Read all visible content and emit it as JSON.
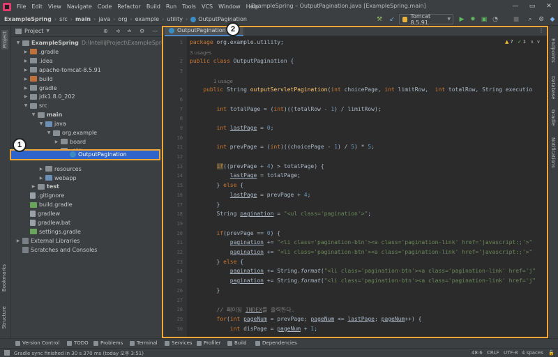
{
  "menubar": {
    "items": [
      "File",
      "Edit",
      "View",
      "Navigate",
      "Code",
      "Refactor",
      "Build",
      "Run",
      "Tools",
      "VCS",
      "Window",
      "Help"
    ],
    "window_title": "ExampleSpring – OutputPagination.java [ExampleSpring.main]"
  },
  "navbar": {
    "crumbs": [
      "ExampleSpring",
      "src",
      "main",
      "java",
      "org",
      "example",
      "utility",
      "OutputPagination"
    ],
    "run_config": "Tomcat 8.5.91"
  },
  "project_panel": {
    "title": "Project",
    "tree": [
      {
        "label": "ExampleSpring",
        "extra": "D:\\IntelliJProject\\ExampleSpring",
        "depth": 0,
        "arrow": "open",
        "icon": "folder",
        "bold": true
      },
      {
        "label": ".gradle",
        "depth": 1,
        "arrow": "closed",
        "icon": "orange"
      },
      {
        "label": ".idea",
        "depth": 1,
        "arrow": "closed",
        "icon": "folder"
      },
      {
        "label": "apache-tomcat-8.5.91",
        "depth": 1,
        "arrow": "closed",
        "icon": "folder"
      },
      {
        "label": "build",
        "depth": 1,
        "arrow": "closed",
        "icon": "orange"
      },
      {
        "label": "gradle",
        "depth": 1,
        "arrow": "closed",
        "icon": "folder"
      },
      {
        "label": "jdk1.8.0_202",
        "depth": 1,
        "arrow": "closed",
        "icon": "folder"
      },
      {
        "label": "src",
        "depth": 1,
        "arrow": "open",
        "icon": "folder"
      },
      {
        "label": "main",
        "depth": 2,
        "arrow": "open",
        "icon": "folder",
        "bold": true
      },
      {
        "label": "java",
        "depth": 3,
        "arrow": "open",
        "icon": "blue"
      },
      {
        "label": "org.example",
        "depth": 4,
        "arrow": "open",
        "icon": "folder"
      },
      {
        "label": "board",
        "depth": 5,
        "arrow": "closed",
        "icon": "folder"
      },
      {
        "label": "utility",
        "depth": 5,
        "arrow": "open",
        "icon": "folder"
      },
      {
        "label": "OutputPagination",
        "depth": 6,
        "arrow": "none",
        "icon": "class",
        "selected": true
      },
      {
        "label": "resources",
        "depth": 3,
        "arrow": "closed",
        "icon": "folder"
      },
      {
        "label": "webapp",
        "depth": 3,
        "arrow": "closed",
        "icon": "blue"
      },
      {
        "label": "test",
        "depth": 2,
        "arrow": "closed",
        "icon": "folder",
        "bold": true
      },
      {
        "label": ".gitignore",
        "depth": 1,
        "arrow": "none",
        "icon": "file"
      },
      {
        "label": "build.gradle",
        "depth": 1,
        "arrow": "none",
        "icon": "green"
      },
      {
        "label": "gradlew",
        "depth": 1,
        "arrow": "none",
        "icon": "file"
      },
      {
        "label": "gradlew.bat",
        "depth": 1,
        "arrow": "none",
        "icon": "file"
      },
      {
        "label": "settings.gradle",
        "depth": 1,
        "arrow": "none",
        "icon": "green"
      },
      {
        "label": "External Libraries",
        "depth": 0,
        "arrow": "closed",
        "icon": "lib"
      },
      {
        "label": "Scratches and Consoles",
        "depth": 0,
        "arrow": "none",
        "icon": "lib"
      }
    ]
  },
  "left_strip": {
    "project": "Project",
    "bookmarks": "Bookmarks",
    "structure": "Structure"
  },
  "right_strip": {
    "endpoints": "Endpoints",
    "database": "Database",
    "gradle": "Gradle",
    "notifications": "Notifications"
  },
  "editor": {
    "tab_label": "OutputPagination.java",
    "inspections": {
      "warnings": "7",
      "ok": "1"
    },
    "lines": [
      {
        "n": "1",
        "html": "<span class=\"kw\">package</span> org.example.utility;"
      },
      {
        "hint": "3 usages"
      },
      {
        "n": "2",
        "html": "<span class=\"kw\">public class</span> OutputPagination {"
      },
      {
        "n": "3",
        "html": ""
      },
      {
        "hint": "1 usage",
        "indent": 1
      },
      {
        "n": "5",
        "html": "    <span class=\"kw\">public</span> String <span class=\"fn\">outputServletPagination</span>(<span class=\"kw\">int</span> choicePage, <span class=\"kw\">int</span> limitRow,  <span class=\"kw\">int</span> totalRow, String executio"
      },
      {
        "n": "6",
        "html": ""
      },
      {
        "n": "7",
        "html": "        <span class=\"kw\">int</span> totalPage = (<span class=\"kw\">int</span>)((totalRow - <span class=\"num\">1</span>) / limitRow);"
      },
      {
        "n": "8",
        "html": ""
      },
      {
        "n": "9",
        "html": "        <span class=\"kw\">int</span> <span class=\"ul\">lastPage</span> = <span class=\"num\">0</span>;"
      },
      {
        "n": "10",
        "html": ""
      },
      {
        "n": "11",
        "html": "        <span class=\"kw\">int</span> prevPage = (<span class=\"kw\">int</span>)((choicePage - <span class=\"num\">1</span>) / <span class=\"num\">5</span>) * <span class=\"num\">5</span>;"
      },
      {
        "n": "12",
        "html": ""
      },
      {
        "n": "13",
        "html": "        <span class=\"kw\" style=\"background:#52503a\">if</span>((prevPage + <span class=\"num\">4</span>) > totalPage) {"
      },
      {
        "n": "14",
        "html": "            <span class=\"ul\">lastPage</span> = totalPage;"
      },
      {
        "n": "15",
        "html": "        } <span class=\"kw\">else</span> {"
      },
      {
        "n": "16",
        "html": "            <span class=\"ul\">lastPage</span> = prevPage + <span class=\"num\">4</span>;"
      },
      {
        "n": "17",
        "html": "        }"
      },
      {
        "n": "18",
        "html": "        String <span class=\"ul\">pagination</span> = <span class=\"str\">\"&lt;ul class='pagination'&gt;\"</span>;"
      },
      {
        "n": "19",
        "html": ""
      },
      {
        "n": "20",
        "html": "        <span class=\"kw\">if</span>(prevPage == <span class=\"num\">0</span>) {"
      },
      {
        "n": "21",
        "html": "            <span class=\"ul\">pagination</span> += <span class=\"str\">\"&lt;li class='pagination-btn'&gt;&lt;a class='pagination-link' href='javascript:;'&gt;\"</span>"
      },
      {
        "n": "22",
        "html": "            <span class=\"ul\">pagination</span> += <span class=\"str\">\"&lt;li class='pagination-btn'&gt;&lt;a class='pagination-link' href='javascript:;'&gt;\"</span>"
      },
      {
        "n": "23",
        "html": "        } <span class=\"kw\">else</span> {"
      },
      {
        "n": "24",
        "html": "            <span class=\"ul\">pagination</span> += String.<span class=\"it\">format</span>(<span class=\"str\">\"&lt;li class='pagination-btn'&gt;&lt;a class='pagination-link' href='j\"</span>"
      },
      {
        "n": "25",
        "html": "            <span class=\"ul\">pagination</span> += String.<span class=\"it\">format</span>(<span class=\"str\">\"&lt;li class='pagination-btn'&gt;&lt;a class='pagination-link' href='j\"</span>"
      },
      {
        "n": "26",
        "html": "        }"
      },
      {
        "n": "27",
        "html": ""
      },
      {
        "n": "28",
        "html": "        <span class=\"cm\">// 페이징 <span class=\"ul\">INDEX</span>를 출력한다.</span>"
      },
      {
        "n": "29",
        "html": "        <span class=\"kw\">for</span>(<span class=\"kw\">int</span> <span class=\"ul\">pageNum</span> = prevPage; <span class=\"ul\">pageNum</span> <= <span class=\"ul\">lastPage</span>; <span class=\"ul\">pageNum</span>++) {"
      },
      {
        "n": "30",
        "html": "            <span class=\"kw\">int</span> disPage = <span class=\"ul\">pageNum</span> + <span class=\"num\">1</span>;"
      }
    ]
  },
  "badges": {
    "one": "1",
    "two": "2"
  },
  "tool_windows": [
    "Version Control",
    "TODO",
    "Problems",
    "Terminal",
    "Services",
    "Profiler",
    "Build",
    "Dependencies"
  ],
  "statusbar": {
    "message": "Gradle sync finished in 30 s 370 ms (today 오후 3:51)",
    "position": "48:6",
    "line_sep": "CRLF",
    "encoding": "UTF-8",
    "indent": "4 spaces"
  }
}
